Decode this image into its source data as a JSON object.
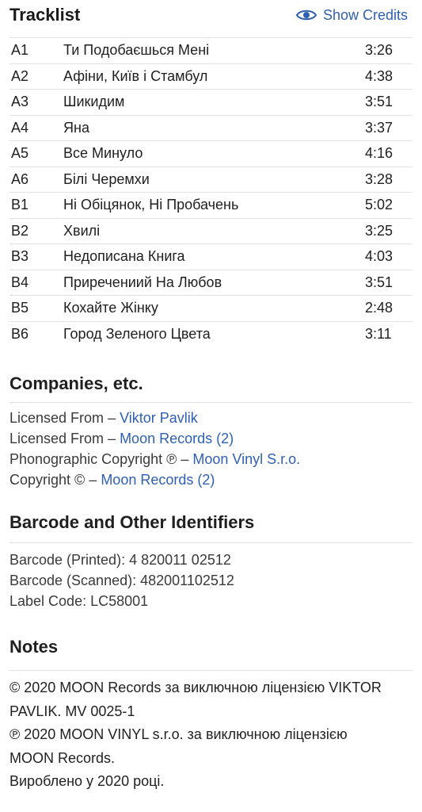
{
  "tracklist": {
    "title": "Tracklist",
    "show_credits_label": "Show Credits",
    "tracks": [
      {
        "pos": "A1",
        "title": "Ти Подобаєшься Мені",
        "duration": "3:26"
      },
      {
        "pos": "A2",
        "title": "Афіни, Київ і Стамбул",
        "duration": "4:38"
      },
      {
        "pos": "A3",
        "title": "Шикидим",
        "duration": "3:51"
      },
      {
        "pos": "A4",
        "title": "Яна",
        "duration": "3:37"
      },
      {
        "pos": "A5",
        "title": "Все Минуло",
        "duration": "4:16"
      },
      {
        "pos": "A6",
        "title": "Білі Черемхи",
        "duration": "3:28"
      },
      {
        "pos": "B1",
        "title": "Ні Обіцянок, Ні Пробачень",
        "duration": "5:02"
      },
      {
        "pos": "B2",
        "title": "Хвилі",
        "duration": "3:25"
      },
      {
        "pos": "B3",
        "title": "Недописана Книга",
        "duration": "4:03"
      },
      {
        "pos": "B4",
        "title": "Приречениий На Любов",
        "duration": "3:51"
      },
      {
        "pos": "B5",
        "title": "Кохайте Жінку",
        "duration": "2:48"
      },
      {
        "pos": "B6",
        "title": "Город Зеленого Цвета",
        "duration": "3:11"
      }
    ]
  },
  "companies": {
    "title": "Companies, etc.",
    "items": [
      {
        "role": "Licensed From – ",
        "name": "Viktor Pavlik"
      },
      {
        "role": "Licensed From – ",
        "name": "Moon Records (2)"
      },
      {
        "role": "Phonographic Copyright ℗ – ",
        "name": "Moon Vinyl S.r.o."
      },
      {
        "role": "Copyright © – ",
        "name": "Moon Records (2)"
      }
    ]
  },
  "identifiers": {
    "title": "Barcode and Other Identifiers",
    "items": [
      "Barcode (Printed): 4 820011 02512",
      "Barcode (Scanned): 482001102512",
      "Label Code: LC58001"
    ]
  },
  "notes": {
    "title": "Notes",
    "lines": [
      "© 2020 MOON Records за виключною ліцензією VIKTOR",
      "PAVLIK. MV 0025-1",
      "℗ 2020 MOON VINYL s.r.o. за виключною ліцензією",
      "MOON Records.",
      "Вироблено у 2020 році."
    ]
  },
  "colors": {
    "link": "#2f5fb3",
    "divider": "#e2e2e2"
  },
  "icons": {
    "credits": "eye-icon"
  }
}
